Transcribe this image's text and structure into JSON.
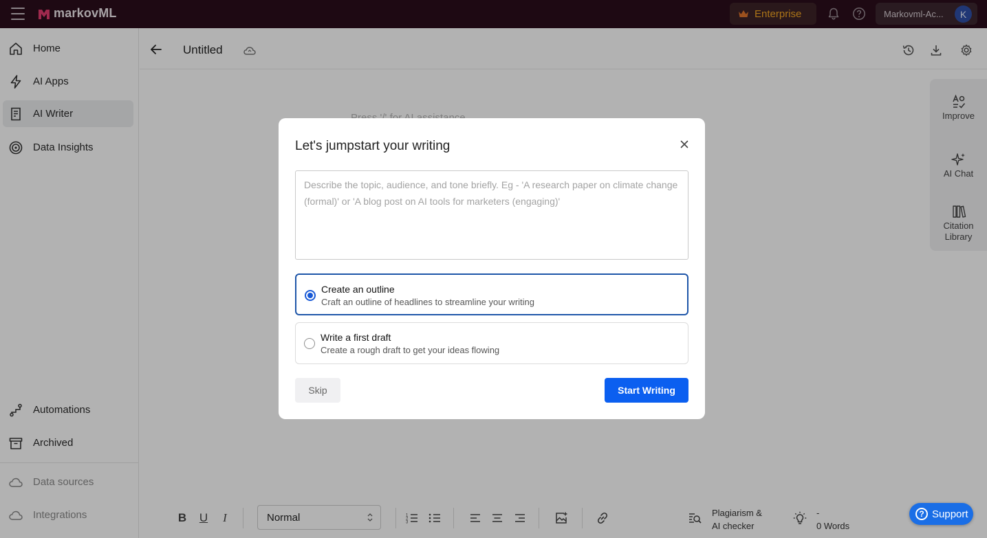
{
  "topbar": {
    "brand": "markovML",
    "enterprise_label": "Enterprise",
    "account_label": "Markovml-Ac...",
    "avatar_initial": "K",
    "brand_color": "#e23b6f",
    "enterprise_color": "#f5a623"
  },
  "sidebar": {
    "items": [
      {
        "label": "Home",
        "icon": "home-icon"
      },
      {
        "label": "AI Apps",
        "icon": "lightning-icon"
      },
      {
        "label": "AI Writer",
        "icon": "document-icon",
        "active": true
      },
      {
        "label": "Data Insights",
        "icon": "target-icon"
      }
    ],
    "bottom_items": [
      {
        "label": "Automations",
        "icon": "workflow-icon"
      },
      {
        "label": "Archived",
        "icon": "archive-icon"
      }
    ],
    "muted_items": [
      {
        "label": "Data sources",
        "icon": "cloud-icon"
      },
      {
        "label": "Integrations",
        "icon": "cloud-icon"
      }
    ]
  },
  "document": {
    "title": "Untitled",
    "placeholder": "Press '/' for AI assistance"
  },
  "right_panel": {
    "tools": [
      {
        "label": "Improve",
        "icon": "improve-icon"
      },
      {
        "label": "AI Chat",
        "icon": "sparkle-icon"
      },
      {
        "label": "Citation Library",
        "icon": "library-icon"
      }
    ]
  },
  "toolbar": {
    "text_style": "Normal",
    "plagiarism_line1": "Plagiarism &",
    "plagiarism_line2": "AI checker",
    "word_stat_line1": "-",
    "word_stat_line2": "0 Words"
  },
  "support": {
    "label": "Support"
  },
  "modal": {
    "title": "Let's jumpstart your writing",
    "prompt_value": "",
    "prompt_placeholder": "Describe the topic, audience, and tone briefly. Eg - 'A research paper on climate change (formal)' or 'A blog post on AI tools for marketers (engaging)'",
    "options": [
      {
        "title": "Create an outline",
        "description": "Craft an outline of headlines to streamline your writing",
        "selected": true
      },
      {
        "title": "Write a first draft",
        "description": "Create a rough draft to get your ideas flowing",
        "selected": false
      }
    ],
    "skip_label": "Skip",
    "start_label": "Start Writing",
    "primary_color": "#0b5ff0"
  }
}
